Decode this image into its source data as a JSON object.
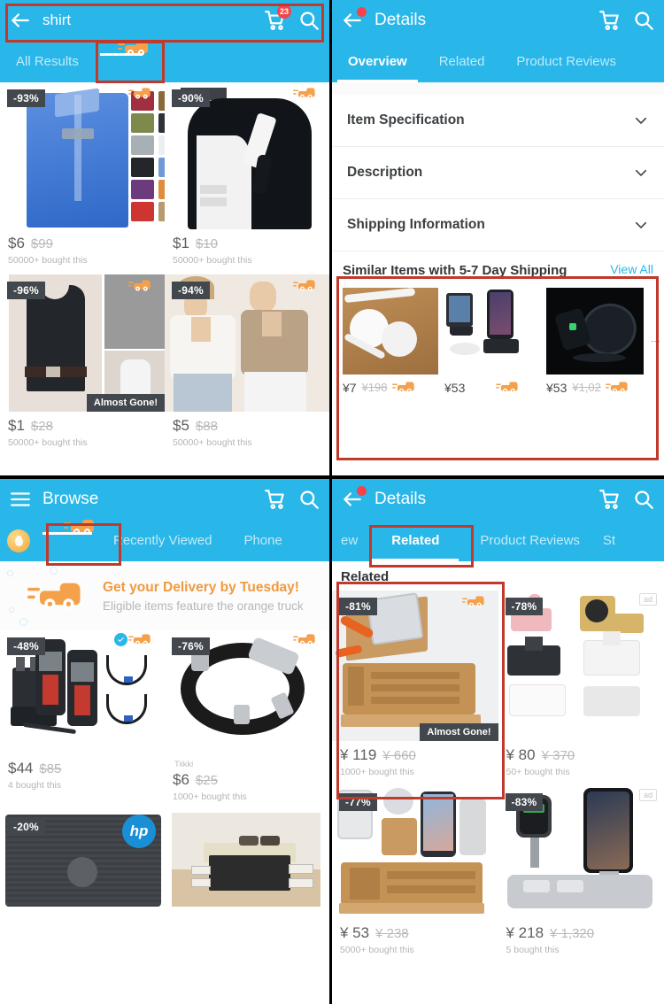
{
  "panels": {
    "search_results": {
      "appbar": {
        "back_icon": "back-arrow-icon",
        "query": "shirt",
        "cart_icon": "cart-icon",
        "cart_badge": "23",
        "search_icon": "search-icon"
      },
      "tabs": [
        {
          "label": "All Results",
          "active": false
        },
        {
          "label": "",
          "icon": "orange-truck-icon",
          "active": true
        }
      ],
      "products": [
        {
          "discount": "-93%",
          "price": "$6",
          "old_price": "$99",
          "bought": "50000+ bought this",
          "truck": true,
          "almost_gone": false
        },
        {
          "discount": "-90%",
          "price": "$1",
          "old_price": "$10",
          "bought": "50000+ bought this",
          "truck": true,
          "almost_gone": false
        },
        {
          "discount": "-96%",
          "price": "$1",
          "old_price": "$28",
          "bought": "50000+ bought this",
          "truck": true,
          "almost_gone": true,
          "almost_gone_label": "Almost Gone!"
        },
        {
          "discount": "-94%",
          "price": "$5",
          "old_price": "$88",
          "bought": "50000+ bought this",
          "truck": true,
          "almost_gone": false
        }
      ]
    },
    "details_overview": {
      "appbar": {
        "back_icon": "back-arrow-icon",
        "title": "Details",
        "cart_icon": "cart-icon",
        "search_icon": "search-icon"
      },
      "tabs": [
        {
          "label": "Overview",
          "active": true
        },
        {
          "label": "Related",
          "active": false
        },
        {
          "label": "Product Reviews",
          "active": false
        }
      ],
      "accordions": [
        {
          "label": "Item Specification",
          "icon": "chevron-down-icon"
        },
        {
          "label": "Description",
          "icon": "chevron-down-icon"
        },
        {
          "label": "Shipping Information",
          "icon": "chevron-down-icon"
        }
      ],
      "similar": {
        "title": "Similar Items with 5-7 Day Shipping",
        "view_all": "View All",
        "items": [
          {
            "price": "¥7",
            "old_price": "¥198",
            "truck": true
          },
          {
            "price": "¥53",
            "old_price": "",
            "truck": true
          },
          {
            "price": "¥53",
            "old_price": "¥1,02",
            "truck": true
          }
        ],
        "overflow_icon": "more-vertical-icon"
      }
    },
    "browse": {
      "appbar": {
        "menu_icon": "hamburger-menu-icon",
        "title": "Browse",
        "cart_icon": "cart-icon",
        "search_icon": "search-icon"
      },
      "tabs": [
        {
          "label": "",
          "icon": "coin-icon",
          "active": false
        },
        {
          "label": "",
          "icon": "orange-truck-icon",
          "active": true
        },
        {
          "label": "Recently Viewed",
          "active": false
        },
        {
          "label": "Phone",
          "active": false
        }
      ],
      "banner": {
        "icon": "orange-truck-icon",
        "headline": "Get your Delivery by Tuesday!",
        "subtext": "Eligible items feature the orange truck"
      },
      "products": [
        {
          "discount": "-48%",
          "price": "$44",
          "old_price": "$85",
          "bought": "4 bought this",
          "truck": true,
          "verified": true,
          "brand": ""
        },
        {
          "discount": "-76%",
          "price": "$6",
          "old_price": "$25",
          "bought": "1000+ bought this",
          "truck": true,
          "verified": false,
          "brand": "Tiikki"
        },
        {
          "discount": "-20%",
          "price": "",
          "old_price": "",
          "bought": "",
          "truck": false,
          "verified": false,
          "brand": ""
        },
        {
          "discount": "",
          "price": "",
          "old_price": "",
          "bought": "",
          "truck": false,
          "verified": false,
          "brand": ""
        }
      ]
    },
    "details_related": {
      "appbar": {
        "back_icon": "back-arrow-icon",
        "title": "Details",
        "cart_icon": "cart-icon",
        "search_icon": "search-icon"
      },
      "tabs": [
        {
          "label": "ew",
          "active": false
        },
        {
          "label": "Related",
          "active": true
        },
        {
          "label": "Product Reviews",
          "active": false
        },
        {
          "label": "St",
          "active": false
        }
      ],
      "section_title": "Related",
      "products": [
        {
          "discount": "-81%",
          "price": "¥ 119",
          "old_price": "¥ 660",
          "bought": "1000+ bought this",
          "truck": true,
          "almost_gone": true,
          "almost_gone_label": "Almost Gone!",
          "ad": false
        },
        {
          "discount": "-78%",
          "price": "¥ 80",
          "old_price": "¥ 370",
          "bought": "50+ bought this",
          "truck": false,
          "almost_gone": false,
          "ad": true,
          "ad_label": "ad"
        },
        {
          "discount": "-77%",
          "price": "¥ 53",
          "old_price": "¥ 238",
          "bought": "5000+ bought this",
          "truck": false,
          "almost_gone": false,
          "ad": false
        },
        {
          "discount": "-83%",
          "price": "¥ 218",
          "old_price": "¥ 1,320",
          "bought": "5 bought this",
          "truck": false,
          "almost_gone": false,
          "ad": true,
          "ad_label": "ad"
        }
      ]
    }
  },
  "colors": {
    "primary": "#29b6e8",
    "annotation": "#c0392b",
    "truck_orange": "#f5a04b",
    "badge_red": "#f4444a",
    "discount_bg": "#42484d"
  }
}
